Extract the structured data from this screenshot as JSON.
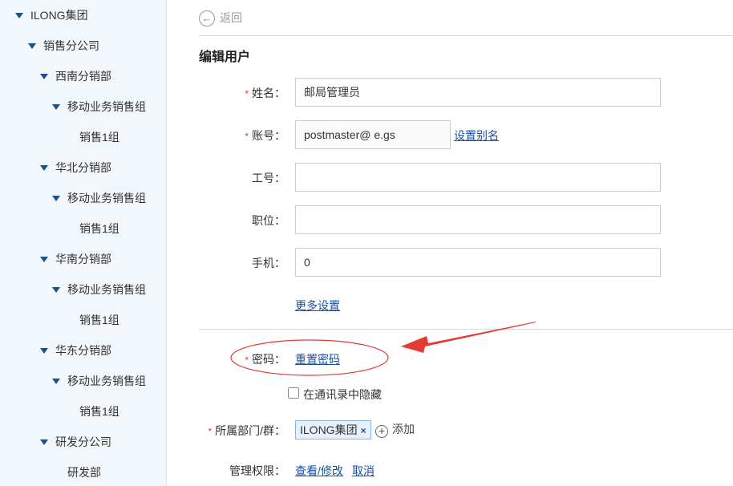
{
  "sidebar": {
    "items": [
      {
        "label": "ILONG集团",
        "expanded": true
      },
      {
        "label": "销售分公司",
        "expanded": true
      },
      {
        "label": "西南分销部",
        "expanded": true
      },
      {
        "label": "移动业务销售组",
        "expanded": true
      },
      {
        "label": "销售1组",
        "expanded": false
      },
      {
        "label": "华北分销部",
        "expanded": true
      },
      {
        "label": "移动业务销售组",
        "expanded": true
      },
      {
        "label": "销售1组",
        "expanded": false
      },
      {
        "label": "华南分销部",
        "expanded": true
      },
      {
        "label": "移动业务销售组",
        "expanded": true
      },
      {
        "label": "销售1组",
        "expanded": false
      },
      {
        "label": "华东分销部",
        "expanded": true
      },
      {
        "label": "移动业务销售组",
        "expanded": true
      },
      {
        "label": "销售1组",
        "expanded": false
      },
      {
        "label": "研发分公司",
        "expanded": true
      },
      {
        "label": "研发部",
        "expanded": false
      }
    ]
  },
  "header": {
    "back_label": "返回",
    "title": "编辑用户"
  },
  "form": {
    "required_mark": "*",
    "name_label": "姓名：",
    "name_value": "邮局管理员",
    "account_label": "账号：",
    "account_value": "postmaster@     e.gs",
    "set_alias_link": "设置别名",
    "employee_id_label": "工号：",
    "employee_id_value": "",
    "position_label": "职位：",
    "position_value": "",
    "mobile_label": "手机：",
    "mobile_value": "0",
    "more_settings_link": "更多设置",
    "password_label": "密码：",
    "reset_password_link": "重置密码",
    "hide_in_contacts_label": "在通讯录中隐藏",
    "hide_in_contacts_checked": false,
    "department_label": "所属部门/群：",
    "department_tag": "ILONG集团",
    "department_tag_remove": "×",
    "add_label": "添加",
    "admin_label": "管理权限：",
    "view_edit_link": "查看/修改",
    "cancel_link": "取消"
  },
  "colors": {
    "annotation_red": "#e53935",
    "link_blue": "#1a4fa0",
    "sidebar_bg": "#f2f7fb"
  },
  "icons": {
    "back": "back-circle-icon",
    "caret": "caret-down-icon",
    "add": "plus-circle-icon",
    "remove": "close-icon"
  }
}
